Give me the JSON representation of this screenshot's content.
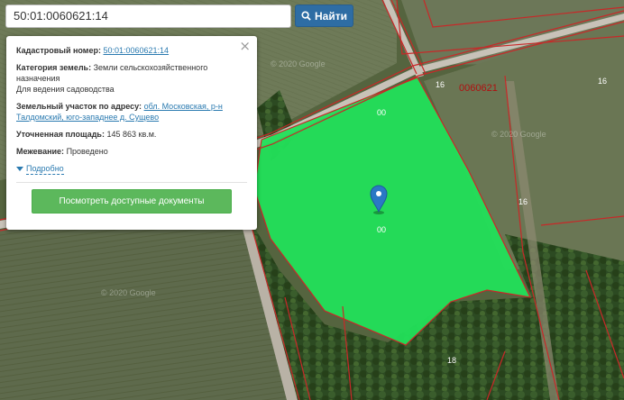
{
  "search": {
    "value": "50:01:0060621:14",
    "button_label": "Найти"
  },
  "popup": {
    "cadastral_label": "Кадастровый номер:",
    "cadastral_value": "50:01:0060621:14",
    "category_label": "Категория земель:",
    "category_value": "Земли сельскохозяйственного назначения",
    "category_use": "Для ведения садоводства",
    "address_label": "Земельный участок по адресу:",
    "address_value": "обл. Московская, р-н Талдомский, юго-западнее д. Сущево",
    "area_label": "Уточненная площадь:",
    "area_value": "145 863 кв.м.",
    "survey_label": "Межевание:",
    "survey_value": "Проведено",
    "details_label": "Подробно",
    "docs_button": "Посмотреть доступные документы",
    "close_symbol": "×"
  },
  "map": {
    "block_number": "0060621",
    "parcel_labels": [
      "16",
      "16",
      "16",
      "18",
      "00",
      "00"
    ],
    "watermarks": [
      "© 2020 Google",
      "© 2020 Google",
      "© 2020 Google"
    ],
    "colors": {
      "parcel_fill": "#22e05a",
      "boundary": "#c82828",
      "road": "#c8c2b8",
      "marker": "#2b78c5"
    }
  }
}
